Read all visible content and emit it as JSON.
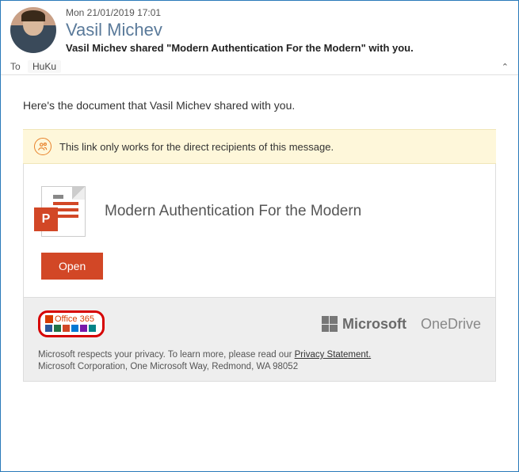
{
  "header": {
    "timestamp": "Mon 21/01/2019 17:01",
    "sender": "Vasil Michev",
    "subject": "Vasil Michev shared \"Modern Authentication For the Modern\" with you."
  },
  "recipients": {
    "to_label": "To",
    "to_name": "HuKu"
  },
  "body": {
    "intro": "Here's the document that Vasil Michev shared with you.",
    "notice": "This link only works for the direct recipients of this message.",
    "doc_title": "Modern Authentication For the Modern",
    "open_label": "Open"
  },
  "footer": {
    "o365_label": "Office 365",
    "ms_label": "Microsoft",
    "onedrive_label": "OneDrive",
    "privacy_text": "Microsoft respects your privacy. To learn more, please read our ",
    "privacy_link": "Privacy Statement.",
    "corp": "Microsoft Corporation, One Microsoft Way, Redmond, WA 98052"
  }
}
